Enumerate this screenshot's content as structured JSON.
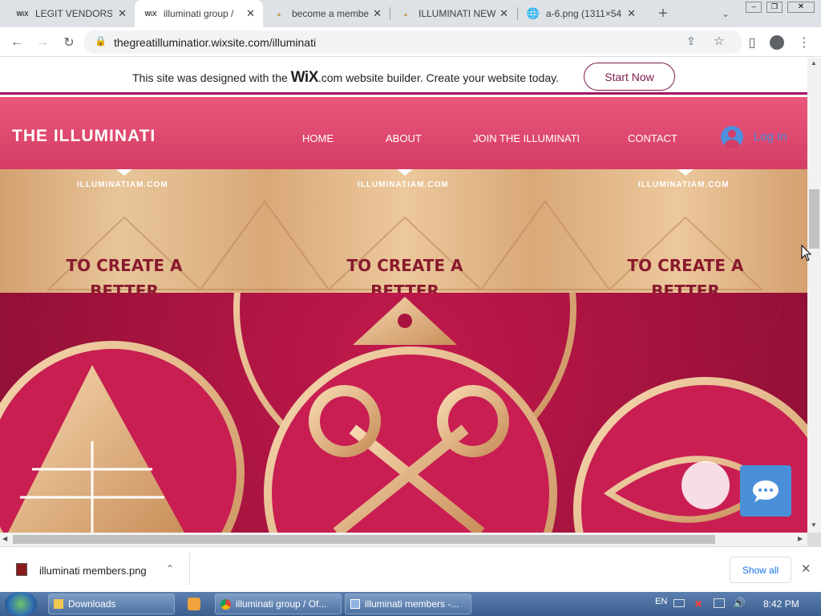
{
  "browser": {
    "tabs": [
      {
        "title": "LEGIT VENDORS |",
        "favicon": "WiX"
      },
      {
        "title": "illuminati group /",
        "favicon": "WiX"
      },
      {
        "title": "become a membe",
        "favicon": "pyramid"
      },
      {
        "title": "ILLUMINATI NEW",
        "favicon": "pyramid"
      },
      {
        "title": "a-6.png (1311×54",
        "favicon": "globe"
      }
    ],
    "url": "thegreatilluminatior.wixsite.com/illuminati"
  },
  "wix_banner": {
    "text_before": "This site was designed with the ",
    "brand": "WiX",
    "text_after": ".com website builder. Create your website today.",
    "cta": "Start Now"
  },
  "site": {
    "title": "THE ILLUMINATI",
    "nav": [
      "HOME",
      "ABOUT",
      "JOIN THE ILLUMINATI",
      "CONTACT"
    ],
    "login": "Log In",
    "hero": {
      "tile_caption": "ILLUMINATIAM.COM",
      "tile_text": "TO CREATE A BETTER WORLD"
    }
  },
  "download": {
    "filename": "illuminati members.png",
    "show_all": "Show all"
  },
  "taskbar": {
    "items": [
      "Downloads",
      "illuminati group / Of...",
      "illuminati members -..."
    ],
    "lang": "EN",
    "clock": "8:42 PM"
  }
}
